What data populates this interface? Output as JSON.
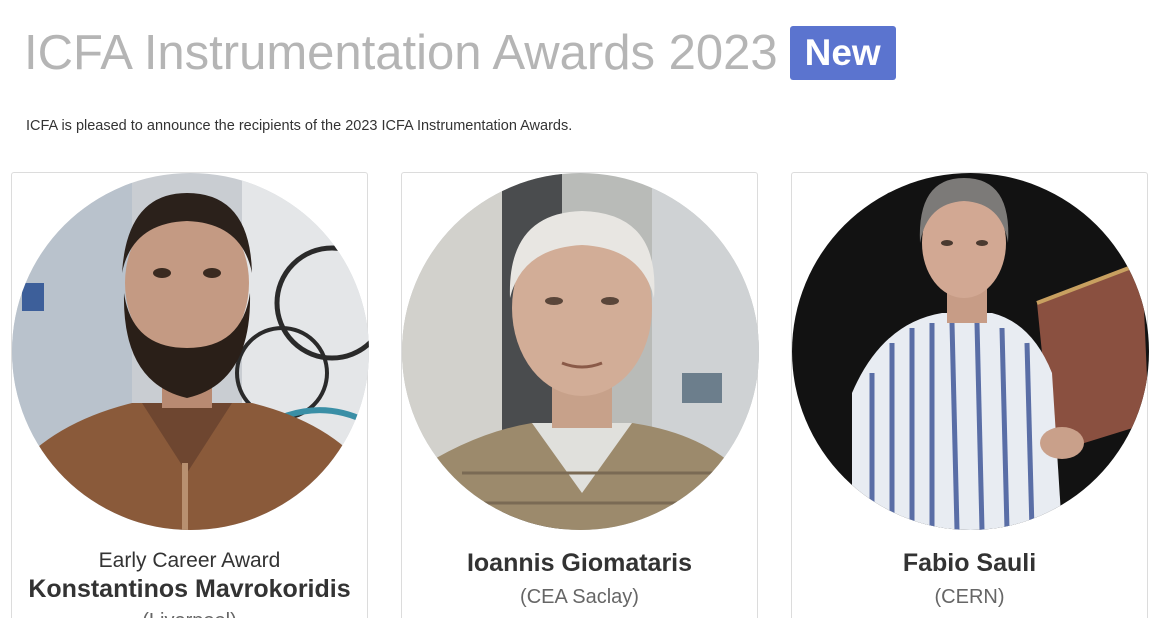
{
  "header": {
    "title": "ICFA Instrumentation Awards 2023",
    "badge": "New"
  },
  "intro": "ICFA is pleased to announce the recipients of the 2023 ICFA Instrumentation Awards.",
  "awardees": [
    {
      "award": "Early Career Award",
      "name": "Konstantinos Mavrokoridis",
      "affiliation": "(Liverpool)"
    },
    {
      "name": "Ioannis Giomataris",
      "affiliation": "(CEA Saclay)"
    },
    {
      "name": "Fabio Sauli",
      "affiliation": "(CERN)"
    }
  ],
  "colors": {
    "badge": "#5b74cf",
    "title": "#b5b5b5",
    "card_border": "#dcdcdc"
  }
}
